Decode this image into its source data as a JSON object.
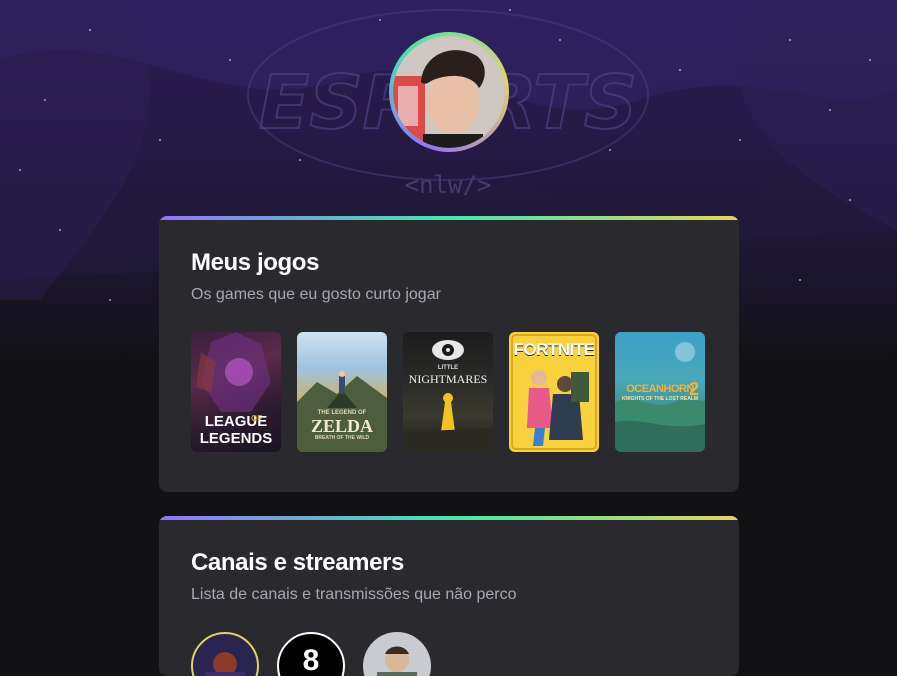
{
  "hero": {
    "watermark": "ESPORTS",
    "watermark_tag": "<nlw/>"
  },
  "profile": {
    "avatar_alt": "profile-avatar-photo"
  },
  "games_card": {
    "title": "Meus jogos",
    "subtitle": "Os games que eu gosto curto jogar",
    "games": [
      {
        "name": "LEAGUE OF LEGENDS",
        "line1": "LEAGUE",
        "line_of": "OF",
        "line2": "LEGENDS"
      },
      {
        "name": "ZELDA",
        "line_small": "THE LEGEND OF",
        "line1": "ZELDA",
        "line2": "BREATH OF THE WILD"
      },
      {
        "name": "LITTLE NIGHTMARES",
        "line_small": "LITTLE",
        "line1": "NIGHTMARES"
      },
      {
        "name": "FORTNITE",
        "line1": "FORTNITE"
      },
      {
        "name": "OCEANHORN 2",
        "line1": "OCEANHORN",
        "line_num": "2",
        "line2": "KNIGHTS OF THE LOST REALM"
      }
    ]
  },
  "streams_card": {
    "title": "Canais e streamers",
    "subtitle": "Lista de canais e transmissões que não perco",
    "streamers": [
      {
        "name": "streamer-1"
      },
      {
        "name": "streamer-2",
        "letter": "8"
      },
      {
        "name": "streamer-3"
      }
    ]
  },
  "colors": {
    "background": "#121214",
    "card": "#29292e",
    "gradient_start": "#9572fc",
    "gradient_mid": "#43e7ad",
    "gradient_end": "#e1d55d"
  }
}
